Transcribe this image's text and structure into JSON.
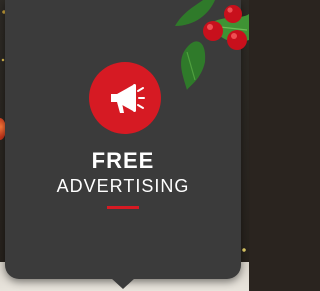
{
  "card": {
    "title": "FREE",
    "subtitle": "ADVERTISING",
    "icon": "megaphone-icon"
  },
  "colors": {
    "accent": "#d61a23",
    "card_background": "#3b3b3b",
    "text": "#ffffff"
  }
}
